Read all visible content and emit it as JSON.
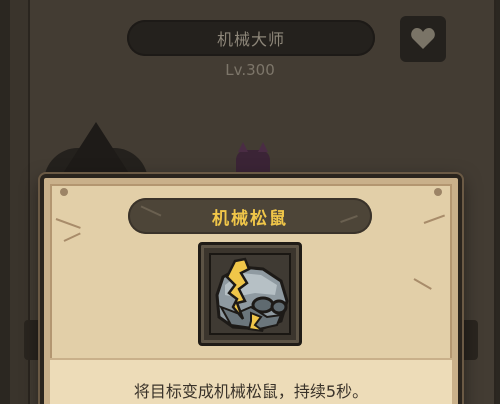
{
  "background_panel": {
    "character_name": "机械大师",
    "level": "Lv.300",
    "favorite_icon": "heart-icon"
  },
  "popup": {
    "title": "机械松鼠",
    "item_icon": "mechanical-squirrel-icon",
    "description": "将目标变成机械松鼠，持续5秒。"
  },
  "colors": {
    "title_text": "#f0c649",
    "popup_background": "#e2cfa8",
    "title_pill": "#4d4538",
    "dim_overlay": "#433c33"
  }
}
